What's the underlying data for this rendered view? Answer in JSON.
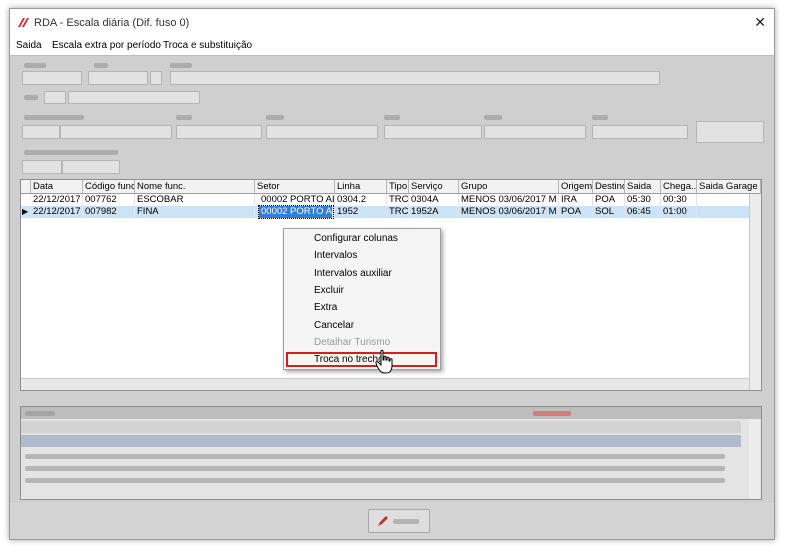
{
  "window": {
    "title": "RDA - Escala diária (Dif. fuso 0)",
    "close": "✕"
  },
  "menu": {
    "items": [
      "Saida",
      "Escala extra por período",
      "Troca e substituição"
    ]
  },
  "grid": {
    "columns": [
      "Data",
      "Código func.",
      "Nome func.",
      "Setor",
      "Linha",
      "Tipo",
      "Serviço",
      "Grupo",
      "Origem",
      "Destino",
      "Saida",
      "Chega...",
      "Saida Garage"
    ],
    "rows": [
      [
        "22/12/2017",
        "007762",
        "ESCOBAR",
        "00002 PORTO ALE",
        "0304.2",
        "TRC",
        "0304A",
        "MENOS 03/06/2017 M",
        "IRA",
        "POA",
        "05:30",
        "00:30",
        ""
      ],
      [
        "22/12/2017",
        "007982",
        "FINA",
        "00002 PORTO ALE",
        "1952",
        "TRC",
        "1952A",
        "MENOS 03/06/2017 M",
        "POA",
        "SOL",
        "06:45",
        "01:00",
        ""
      ]
    ],
    "selected_row": 1,
    "row_marker": "▶"
  },
  "context_menu": {
    "items": [
      {
        "label": "Configurar colunas",
        "enabled": true
      },
      {
        "label": "Intervalos",
        "enabled": true
      },
      {
        "label": "Intervalos auxiliar",
        "enabled": true
      },
      {
        "label": "Excluir",
        "enabled": true
      },
      {
        "label": "Extra",
        "enabled": true
      },
      {
        "label": "Cancelar",
        "enabled": true
      },
      {
        "label": "Detalhar Turismo",
        "enabled": false
      },
      {
        "label": "Troca no trecho",
        "enabled": true,
        "highlighted": true
      }
    ]
  },
  "colors": {
    "accent_red": "#d21f1f",
    "selection_blue": "#2f7fd8",
    "logo_red": "#d8262a"
  }
}
